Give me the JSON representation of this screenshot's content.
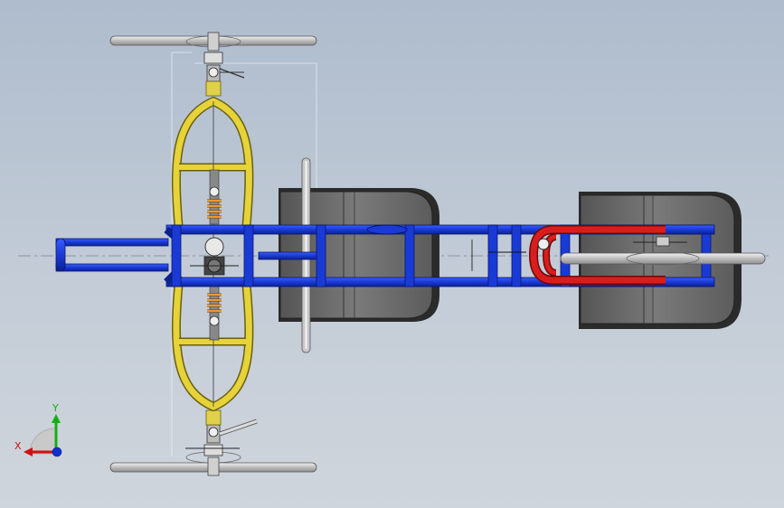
{
  "view": {
    "background_top": "#aebccd",
    "background_bottom": "#cfd5dc"
  },
  "model": {
    "frame_color": "#1e3fd0",
    "front_frame_color": "#d4c21a",
    "rear_frame_color": "#d01c1c",
    "seat_color": "#6a6a6a",
    "wheel_color": "#d8d8d8",
    "spring_color": "#d9821e"
  },
  "triad": {
    "x_label": "X",
    "y_label": "Y",
    "x_color": "#d01010",
    "y_color": "#10b010",
    "z_color": "#1030d0"
  }
}
